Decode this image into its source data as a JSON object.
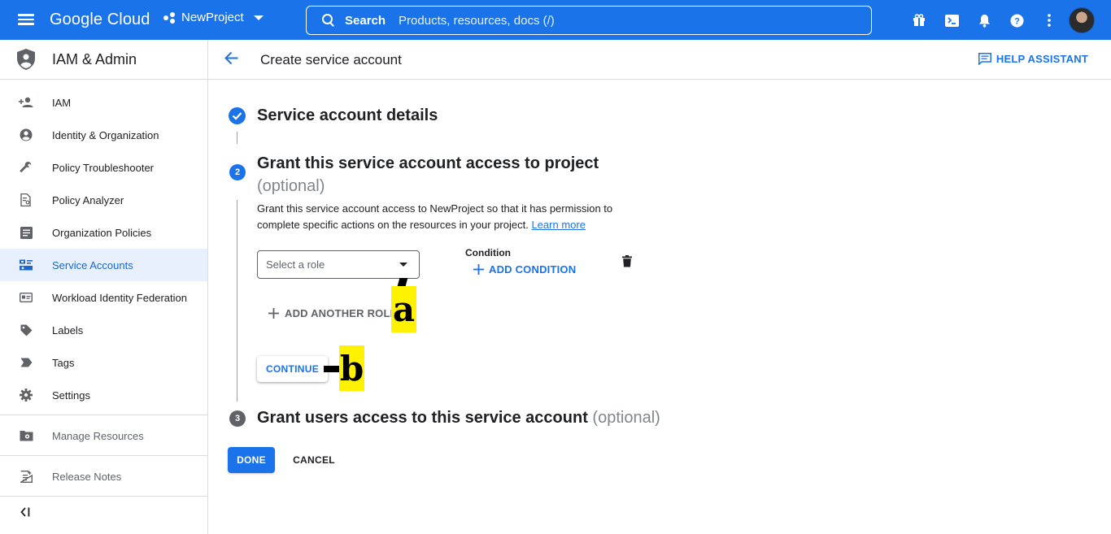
{
  "topbar": {
    "logo": "Google Cloud",
    "project": "NewProject",
    "search_label": "Search",
    "search_placeholder": "Products, resources, docs (/)"
  },
  "sidebar": {
    "title": "IAM & Admin",
    "items": [
      {
        "label": "IAM",
        "icon": "person-add-icon"
      },
      {
        "label": "Identity & Organization",
        "icon": "account-circle-icon"
      },
      {
        "label": "Policy Troubleshooter",
        "icon": "wrench-icon"
      },
      {
        "label": "Policy Analyzer",
        "icon": "document-search-icon"
      },
      {
        "label": "Organization Policies",
        "icon": "list-doc-icon"
      },
      {
        "label": "Service Accounts",
        "icon": "service-account-icon",
        "active": true
      },
      {
        "label": "Workload Identity Federation",
        "icon": "id-card-icon"
      },
      {
        "label": "Labels",
        "icon": "label-icon"
      },
      {
        "label": "Tags",
        "icon": "tag-icon"
      },
      {
        "label": "Settings",
        "icon": "gear-icon"
      }
    ],
    "manage_resources": "Manage Resources",
    "release_notes": "Release Notes"
  },
  "header": {
    "title": "Create service account",
    "help": "HELP ASSISTANT"
  },
  "steps": {
    "step1_title": "Service account details",
    "step2_number": "2",
    "step2_title": "Grant this service account access to project",
    "step2_optional": "(optional)",
    "step2_desc": "Grant this service account access to NewProject so that it has permission to complete specific actions on the resources in your project.",
    "learn_more": "Learn more",
    "role_placeholder": "Select a role",
    "condition_label": "Condition",
    "add_condition": "ADD CONDITION",
    "add_another_role": "ADD ANOTHER ROLE",
    "continue": "CONTINUE",
    "step3_number": "3",
    "step3_title": "Grant users access to this service account",
    "step3_optional": "(optional)"
  },
  "actions": {
    "done": "DONE",
    "cancel": "CANCEL"
  },
  "markers": {
    "a": "a",
    "b": "b"
  },
  "colors": {
    "brand_blue": "#1a73e8",
    "active_bg": "#e8f0fe",
    "marker_yellow": "#fff200"
  }
}
